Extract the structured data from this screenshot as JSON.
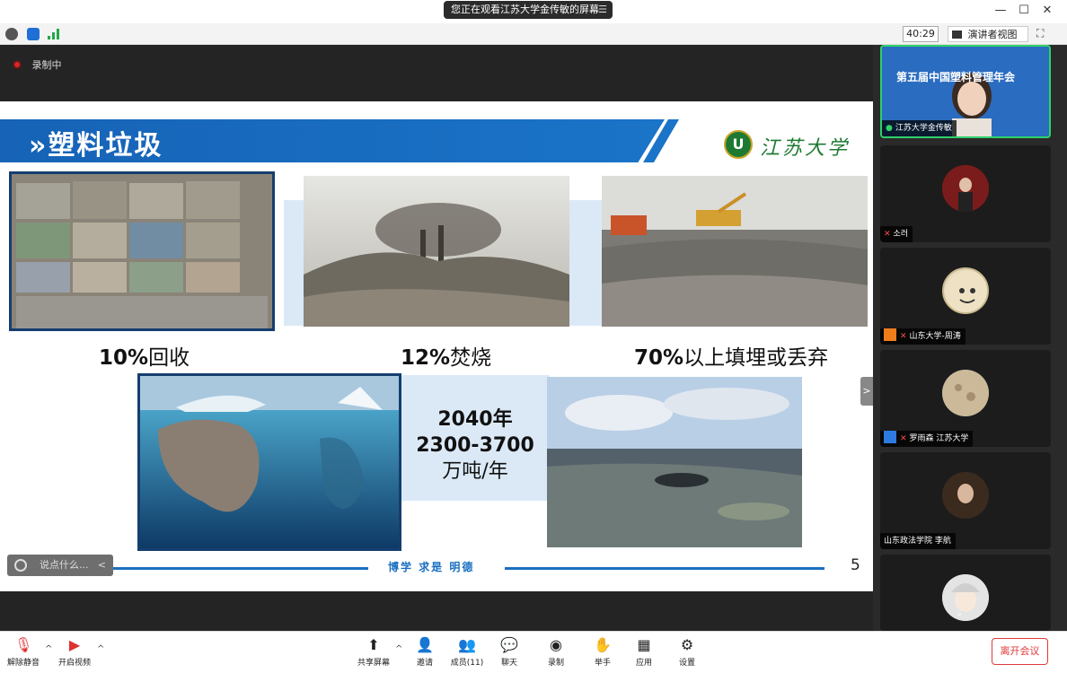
{
  "titlebar": {
    "share_notice": "您正在观看江苏大学金传敏的屏幕",
    "menu_glyph": "☰",
    "minimize": "—",
    "maximize": "☐",
    "close": "✕"
  },
  "toolstrip": {
    "timer": "40:29",
    "view_label": "演讲者视图",
    "view_caret": "▾",
    "expand_glyph": "⛶"
  },
  "recording": {
    "label": "录制中"
  },
  "slide": {
    "title": "»塑料垃圾",
    "logo_seal": "U",
    "logo_text": "江苏大学",
    "captions": {
      "recycle_pct": "10%",
      "recycle_txt": "回收",
      "incinerate_pct": "12%",
      "incinerate_txt": "焚烧",
      "landfill_pct": "70%",
      "landfill_txt": "以上填埋或丢弃"
    },
    "projection": {
      "year": "2040年",
      "range": "2300-3700",
      "unit": "万吨/年"
    },
    "footer_motto": "博学 求是 明德",
    "page_number": "5"
  },
  "chat": {
    "placeholder": "说点什么...",
    "arrow": "<"
  },
  "collapse_glyph": ">",
  "participants": [
    {
      "name": "江苏大学金传敏",
      "banner_title": "第五届中国塑料管理年会"
    },
    {
      "name": "소러"
    },
    {
      "name": "山东大学-周涛"
    },
    {
      "name": "罗雨森 江苏大学"
    },
    {
      "name": "山东政法学院 李航"
    },
    {
      "name": ""
    }
  ],
  "bottombar": {
    "mute": "解除静音",
    "video": "开启视频",
    "share": "共享屏幕",
    "invite": "邀请",
    "members": "成员(11)",
    "chat": "聊天",
    "record": "录制",
    "raise_hand": "举手",
    "apps": "应用",
    "settings": "设置",
    "leave": "离开会议",
    "caret": "^"
  },
  "colors": {
    "accent_blue": "#1a6fc0",
    "leave_red": "#e03a3a",
    "active_green": "#2fd16a"
  }
}
